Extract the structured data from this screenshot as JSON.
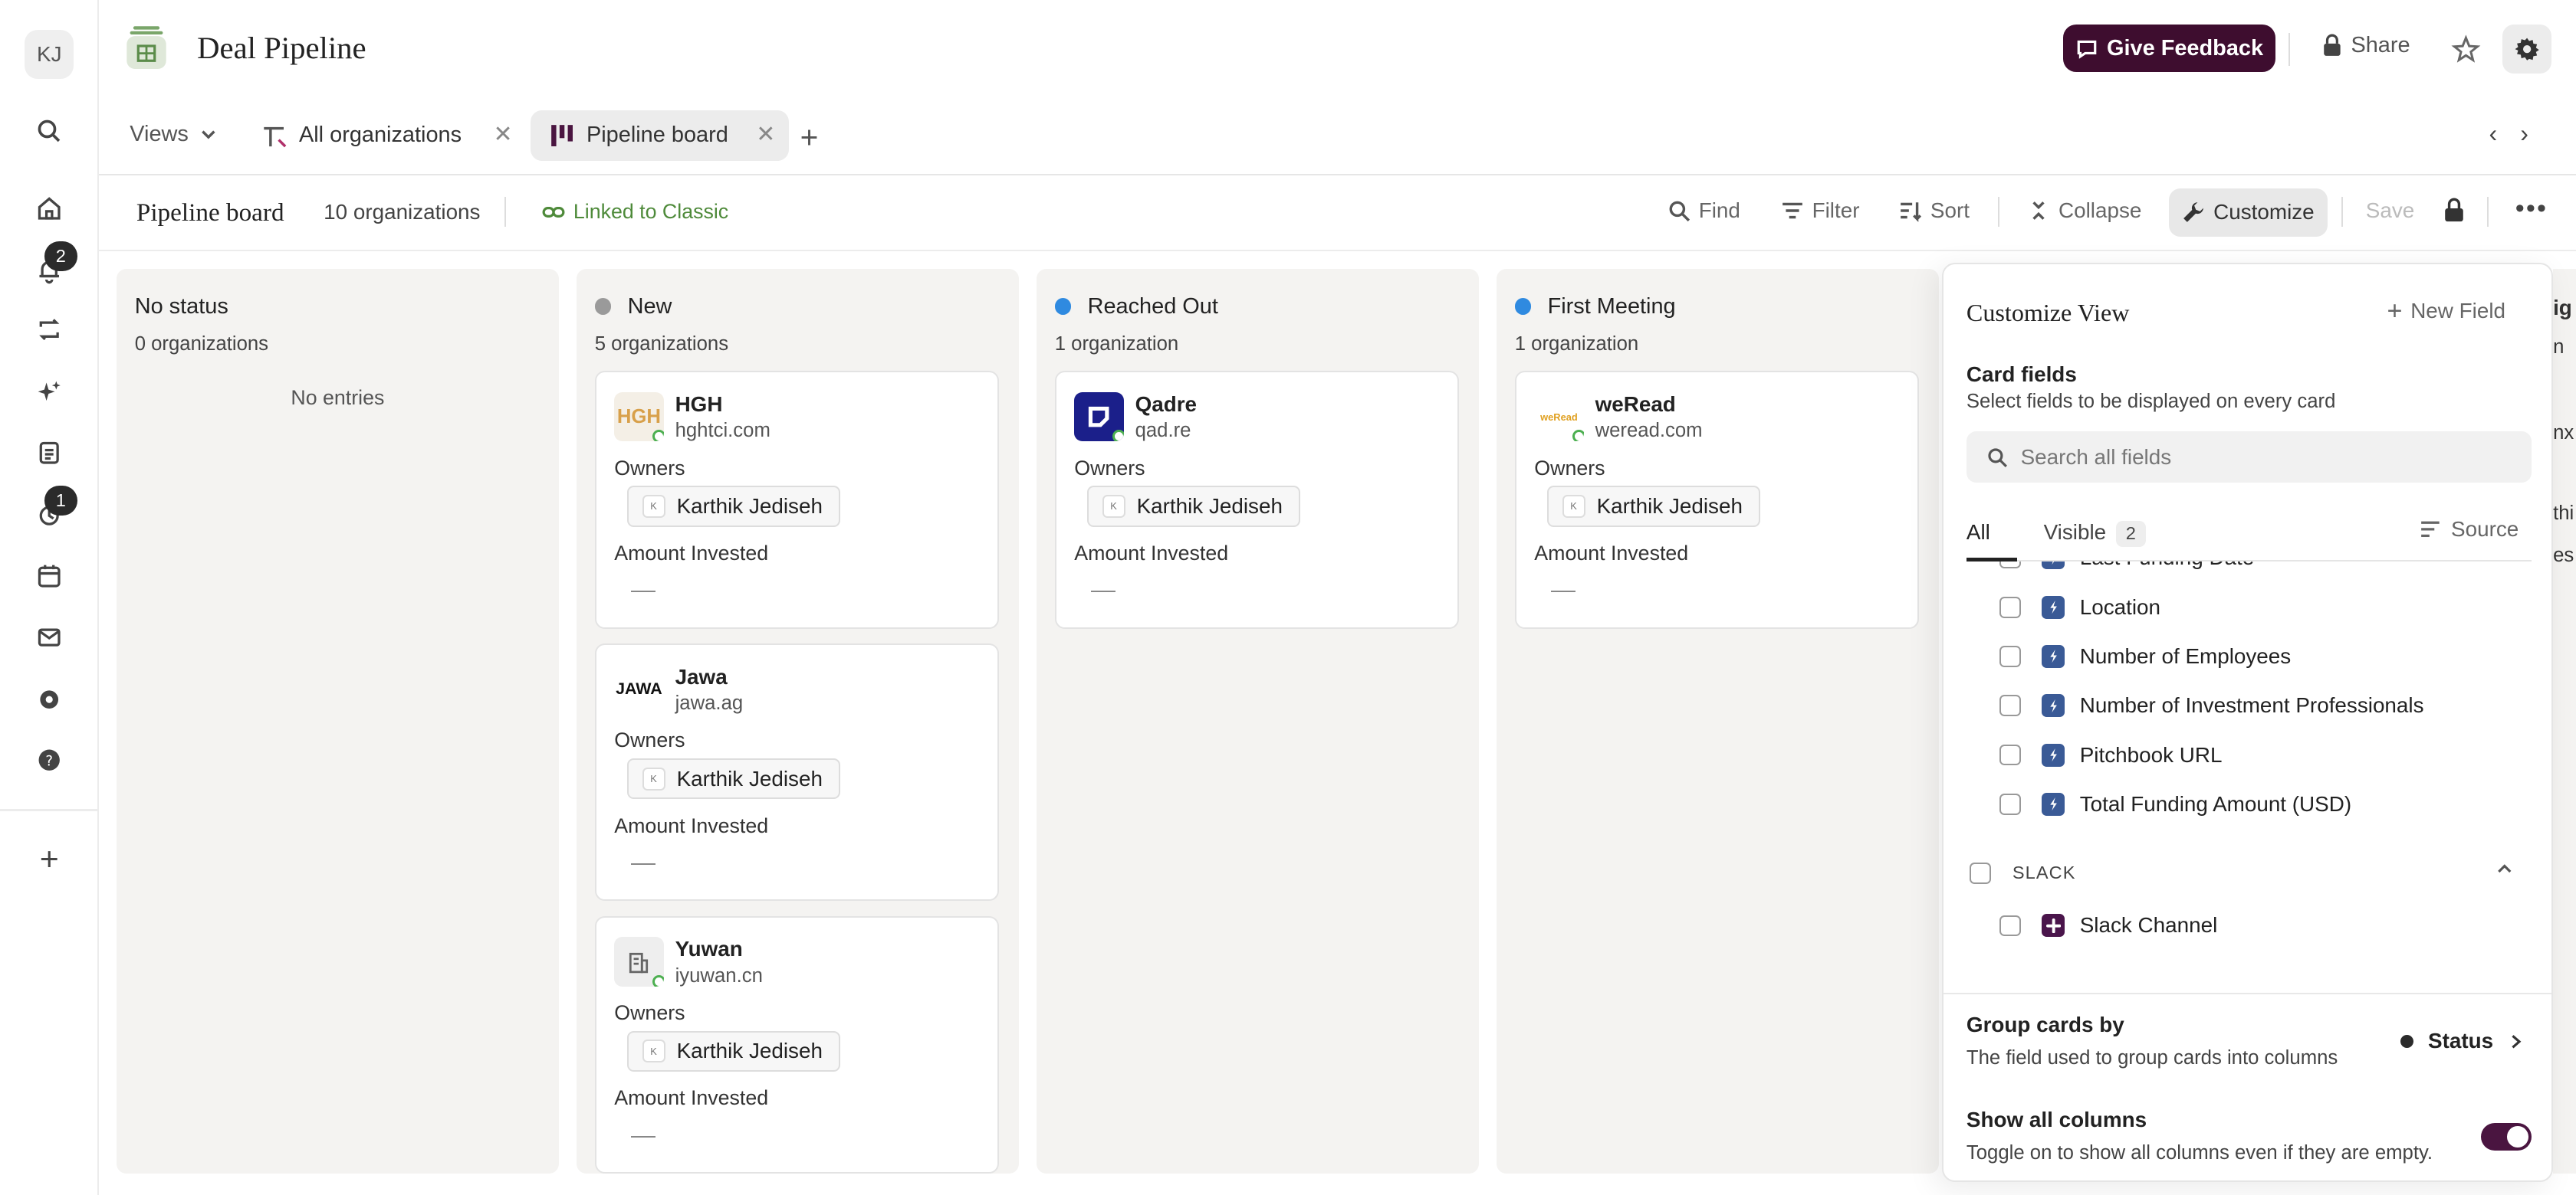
{
  "user": {
    "initials": "KJ"
  },
  "rail": {
    "notifications_badge": "2",
    "activity_badge": "1"
  },
  "header": {
    "title": "Deal Pipeline",
    "feedback_label": "Give Feedback",
    "share_label": "Share"
  },
  "tabs": {
    "views_label": "Views",
    "items": [
      {
        "label": "All organizations"
      },
      {
        "label": "Pipeline board"
      }
    ]
  },
  "toolbar": {
    "title": "Pipeline board",
    "count": "10 organizations",
    "linked": "Linked to Classic",
    "find": "Find",
    "filter": "Filter",
    "sort": "Sort",
    "collapse": "Collapse",
    "customize": "Customize",
    "save": "Save"
  },
  "columns": [
    {
      "title": "No status",
      "count": "0 organizations",
      "empty": "No entries",
      "dot_color": ""
    },
    {
      "title": "New",
      "count": "5 organizations",
      "dot_color": "#9a9a9a"
    },
    {
      "title": "Reached Out",
      "count": "1 organization",
      "dot_color": "#2f8ae0"
    },
    {
      "title": "First Meeting",
      "count": "1 organization",
      "dot_color": "#2f8ae0"
    }
  ],
  "cards": [
    {
      "name": "HGH",
      "domain": "hghtci.com",
      "logo_text": "HGH",
      "owners_label": "Owners",
      "owner": "Karthik Jediseh",
      "amount_label": "Amount Invested"
    },
    {
      "name": "Jawa",
      "domain": "jawa.ag",
      "logo_text": "JAWA",
      "owners_label": "Owners",
      "owner": "Karthik Jediseh",
      "amount_label": "Amount Invested"
    },
    {
      "name": "Yuwan",
      "domain": "iyuwan.cn",
      "logo_text": "",
      "owners_label": "Owners",
      "owner": "Karthik Jediseh",
      "amount_label": "Amount Invested"
    },
    {
      "name": "Qadre",
      "domain": "qad.re",
      "logo_text": "",
      "owners_label": "Owners",
      "owner": "Karthik Jediseh",
      "amount_label": "Amount Invested"
    },
    {
      "name": "weRead",
      "domain": "weread.com",
      "logo_text": "weRead",
      "owners_label": "Owners",
      "owner": "Karthik Jediseh",
      "amount_label": "Amount Invested"
    }
  ],
  "panel": {
    "title": "Customize View",
    "new_field": "New Field",
    "card_fields_title": "Card fields",
    "card_fields_sub": "Select fields to be displayed on every card",
    "search_placeholder": "Search all fields",
    "tab_all": "All",
    "tab_visible": "Visible",
    "visible_count": "2",
    "source": "Source",
    "fields": [
      "Last Funding Date",
      "Location",
      "Number of Employees",
      "Number of Investment Professionals",
      "Pitchbook URL",
      "Total Funding Amount (USD)"
    ],
    "group_slack": "SLACK",
    "slack_fields": [
      "Slack Channel"
    ],
    "group_by_title": "Group cards by",
    "group_by_sub": "The field used to group cards into columns",
    "group_by_value": "Status",
    "show_all_title": "Show all columns",
    "show_all_sub": "Toggle on to show all columns even if they are empty.",
    "show_all_enabled": true
  },
  "peek": {
    "fragments": [
      "ig",
      "n",
      "nx",
      "thi",
      "es"
    ]
  },
  "colors": {
    "feedback_bg": "#3e0d2f",
    "accent_green": "#4e8a3a",
    "toggle_on": "#4a1540",
    "field_icon": "#3a5a96"
  }
}
